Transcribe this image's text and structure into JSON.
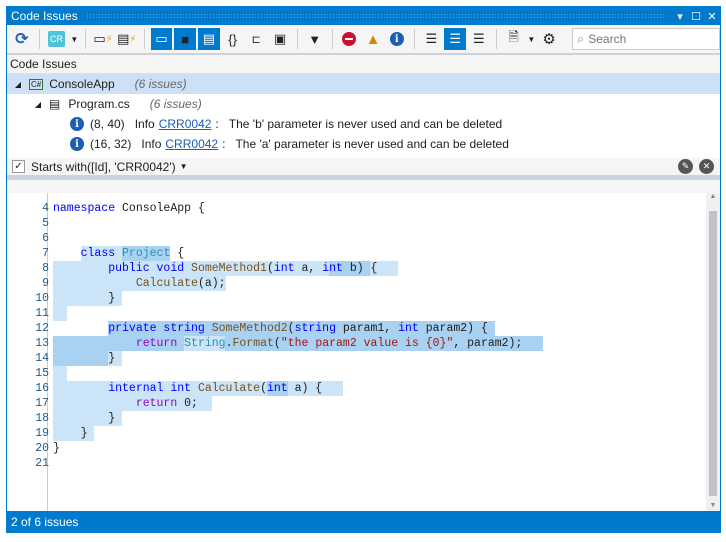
{
  "window": {
    "title": "Code Issues",
    "controls": [
      "▾",
      "☐",
      "✕"
    ]
  },
  "toolbar": {
    "search_placeholder": "Search",
    "cr_label": "CR"
  },
  "section_header": "Code Issues",
  "tree": {
    "project": {
      "name": "ConsoleApp",
      "count": "(6 issues)"
    },
    "file": {
      "name": "Program.cs",
      "count": "(6 issues)"
    },
    "issues": [
      {
        "pos": "(8, 40)",
        "severity": "Info",
        "code": "CRR0042",
        "sep": ":",
        "message": "The 'b' parameter is never used and can be deleted"
      },
      {
        "pos": "(16, 32)",
        "severity": "Info",
        "code": "CRR0042",
        "sep": ":",
        "message": "The 'a' parameter is never used and can be deleted"
      }
    ]
  },
  "filter": {
    "text": "Starts with([Id], 'CRR0042')",
    "checked": true
  },
  "code": {
    "lines": [
      {
        "n": "4",
        "tokens": [
          [
            "kw",
            "namespace"
          ],
          [
            "pl",
            " ConsoleApp {"
          ]
        ]
      },
      {
        "n": "5",
        "tokens": []
      },
      {
        "n": "6",
        "tokens": []
      },
      {
        "n": "7",
        "tokens": [
          [
            "pl",
            "    "
          ],
          [
            "kw",
            "class"
          ],
          [
            "pl",
            " "
          ],
          [
            "ty",
            "Project"
          ],
          [
            "pl",
            " {"
          ]
        ]
      },
      {
        "n": "8",
        "tokens": [
          [
            "pl",
            "        "
          ],
          [
            "kw",
            "public void"
          ],
          [
            "pl",
            " "
          ],
          [
            "me",
            "SomeMethod1"
          ],
          [
            "pl",
            "("
          ],
          [
            "kw",
            "int"
          ],
          [
            "pl",
            " a, "
          ],
          [
            "kw",
            "int"
          ],
          [
            "pl",
            " b) {"
          ]
        ]
      },
      {
        "n": "9",
        "tokens": [
          [
            "pl",
            "            "
          ],
          [
            "me",
            "Calculate"
          ],
          [
            "pl",
            "(a);"
          ]
        ]
      },
      {
        "n": "10",
        "tokens": [
          [
            "pl",
            "        }"
          ]
        ]
      },
      {
        "n": "11",
        "tokens": []
      },
      {
        "n": "12",
        "tokens": [
          [
            "pl",
            "        "
          ],
          [
            "kw",
            "private string"
          ],
          [
            "pl",
            " "
          ],
          [
            "me",
            "SomeMethod2"
          ],
          [
            "pl",
            "("
          ],
          [
            "kw",
            "string"
          ],
          [
            "pl",
            " param1, "
          ],
          [
            "kw",
            "int"
          ],
          [
            "pl",
            " param2) {"
          ]
        ]
      },
      {
        "n": "13",
        "tokens": [
          [
            "pl",
            "            "
          ],
          [
            "rt",
            "return"
          ],
          [
            "pl",
            " "
          ],
          [
            "ty",
            "String"
          ],
          [
            "pl",
            "."
          ],
          [
            "me",
            "Format"
          ],
          [
            "pl",
            "("
          ],
          [
            "st",
            "\"the param2 value is {0}\""
          ],
          [
            "pl",
            ", param2);"
          ]
        ]
      },
      {
        "n": "14",
        "tokens": [
          [
            "pl",
            "        }"
          ]
        ]
      },
      {
        "n": "15",
        "tokens": []
      },
      {
        "n": "16",
        "tokens": [
          [
            "pl",
            "        "
          ],
          [
            "kw",
            "internal int"
          ],
          [
            "pl",
            " "
          ],
          [
            "me",
            "Calculate"
          ],
          [
            "pl",
            "("
          ],
          [
            "kw",
            "int"
          ],
          [
            "pl",
            " a) {"
          ]
        ]
      },
      {
        "n": "17",
        "tokens": [
          [
            "pl",
            "            "
          ],
          [
            "rt",
            "return"
          ],
          [
            "pl",
            " 0;"
          ]
        ]
      },
      {
        "n": "18",
        "tokens": [
          [
            "pl",
            "        }"
          ]
        ]
      },
      {
        "n": "19",
        "tokens": [
          [
            "pl",
            "    }"
          ]
        ]
      },
      {
        "n": "20",
        "tokens": [
          [
            "pl",
            "}"
          ]
        ]
      },
      {
        "n": "21",
        "tokens": []
      }
    ]
  },
  "status": "2 of 6 issues",
  "colors": {
    "accent": "#007acc",
    "highlight": "#cce4f7",
    "highlight_strong": "#a9d1f2",
    "info": "#1a5fb4",
    "error": "#c8102e",
    "warning": "#d48a00"
  }
}
